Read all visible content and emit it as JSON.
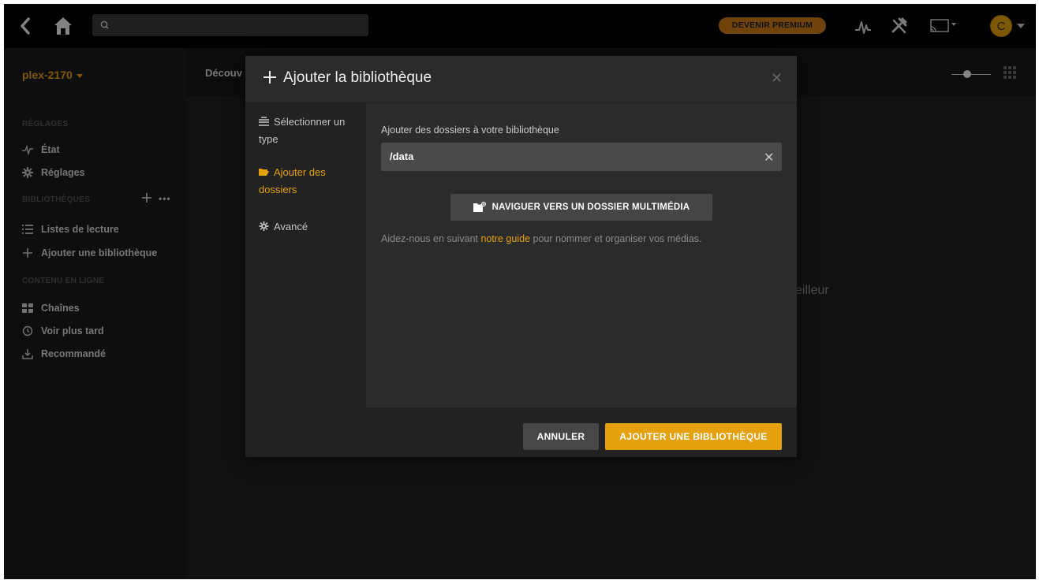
{
  "topbar": {
    "search_placeholder": "",
    "premium_label": "DEVENIR PREMIUM",
    "avatar_letter": "C"
  },
  "sidebar": {
    "server_name": "plex-2170",
    "sections": {
      "settings": "RÉGLAGES",
      "libraries": "BIBLIOTHÈQUES",
      "online": "CONTENU EN LIGNE"
    },
    "more_label": "•••",
    "items": {
      "status": "État",
      "settings": "Réglages",
      "playlists": "Listes de lecture",
      "add_library": "Ajouter une bibliothèque",
      "channels": "Chaînes",
      "watch_later": "Voir plus tard",
      "recommended": "Recommandé"
    }
  },
  "main": {
    "tab_label": "Découv",
    "behind_text": "eilleur"
  },
  "modal": {
    "title": "Ajouter la bibliothèque",
    "close_label": "✕",
    "steps": [
      {
        "label": "Sélectionner un type"
      },
      {
        "label": "Ajouter des dossiers"
      },
      {
        "label": "Avancé"
      }
    ],
    "folders_label": "Ajouter des dossiers à votre bibliothèque",
    "folder_value": "/data",
    "clear_label": "✕",
    "browse_label": "NAVIGUER VERS UN DOSSIER MULTIMÉDIA",
    "help_prefix": "Aidez-nous en suivant ",
    "help_link": "notre guide",
    "help_suffix": " pour nommer et organiser vos médias.",
    "cancel_label": "ANNULER",
    "add_label": "AJOUTER UNE BIBLIOTHÈQUE"
  },
  "colors": {
    "accent": "#e5a00d",
    "premium": "#cc7b19",
    "background": "#1f1f1f"
  }
}
